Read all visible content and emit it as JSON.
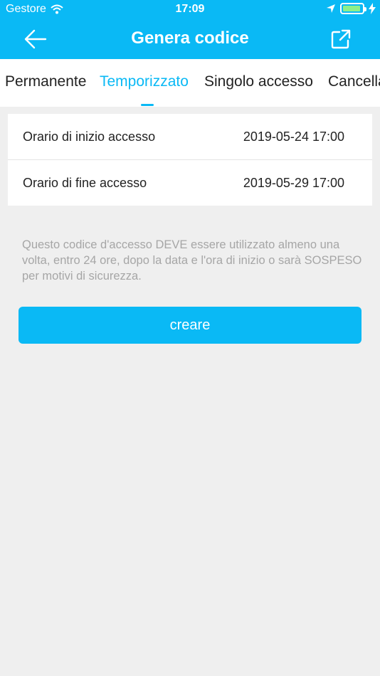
{
  "status_bar": {
    "carrier": "Gestore",
    "time": "17:09"
  },
  "nav": {
    "title": "Genera codice",
    "back_icon": "arrow-left-icon",
    "share_icon": "external-link-icon"
  },
  "tabs": [
    {
      "label": "Permanente",
      "active": false
    },
    {
      "label": "Temporizzato",
      "active": true
    },
    {
      "label": "Singolo accesso",
      "active": false
    },
    {
      "label": "Cancella",
      "active": false
    }
  ],
  "form": {
    "start": {
      "label": "Orario di inizio accesso",
      "value": "2019-05-24 17:00"
    },
    "end": {
      "label": "Orario di fine accesso",
      "value": "2019-05-29 17:00"
    }
  },
  "notice": "Questo codice d'accesso DEVE essere utilizzato almeno una volta, entro 24 ore, dopo la data e l'ora di inizio o sarà SOSPESO per motivi di sicurezza.",
  "create_label": "creare",
  "colors": {
    "accent": "#0ab9f5",
    "background": "#efefef",
    "notice_text": "#a6a6a6"
  }
}
